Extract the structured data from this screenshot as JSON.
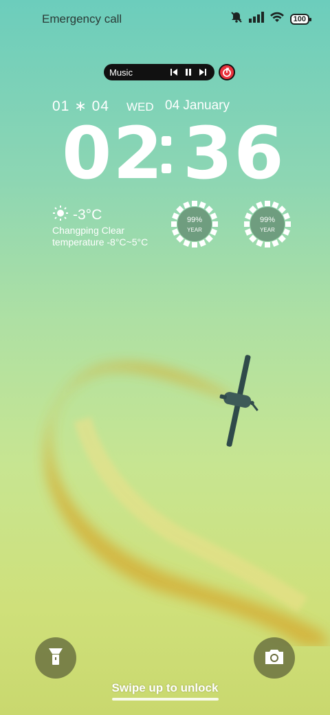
{
  "status_bar": {
    "carrier": "Emergency call",
    "battery": "100",
    "icons": [
      "mute-icon",
      "signal-icon",
      "wifi-icon",
      "battery-icon"
    ]
  },
  "music": {
    "label": "Music",
    "controls": [
      "previous-icon",
      "pause-icon",
      "next-icon"
    ]
  },
  "date": {
    "numeric": "01 ∗ 04",
    "weekday": "WED",
    "long": "04 January"
  },
  "clock": {
    "hours": "02",
    "minutes": "36"
  },
  "weather": {
    "temperature": "-3°C",
    "location": "Changping Clear",
    "range": "temperature -8°C~5°C",
    "icon": "sun-icon"
  },
  "rings": [
    {
      "percent": "99%",
      "unit": "YEAR"
    },
    {
      "percent": "99%",
      "unit": "YEAR"
    }
  ],
  "bottom": {
    "swipe_text": "Swipe up to unlock",
    "left_icon": "flashlight-icon",
    "right_icon": "camera-icon"
  },
  "colors": {
    "sky_top": "#6ccdbc",
    "sky_bottom": "#c9d86e",
    "smoke": "#d4b23a",
    "accent_red": "#e8323c"
  }
}
